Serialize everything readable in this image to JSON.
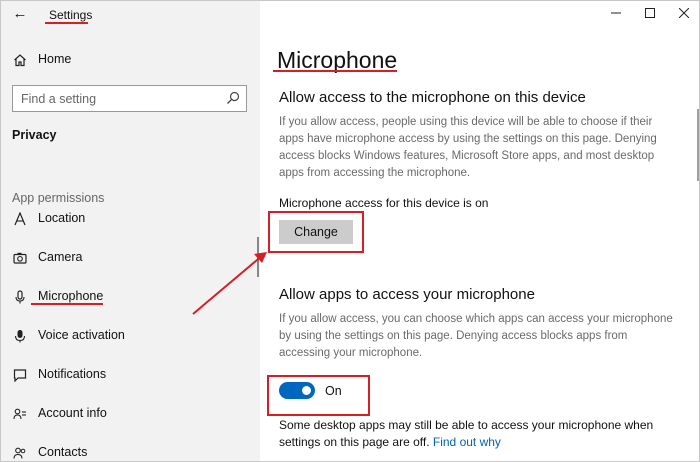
{
  "window": {
    "app_title": "Settings",
    "controls": [
      {
        "name": "minimize",
        "icon": "minimize-icon"
      },
      {
        "name": "maximize",
        "icon": "maximize-icon"
      },
      {
        "name": "close",
        "icon": "close-icon"
      }
    ]
  },
  "sidebar": {
    "home_label": "Home",
    "search_placeholder": "Find a setting",
    "section_heading": "Privacy",
    "group_label": "App permissions",
    "items": [
      {
        "label": "Location",
        "icon": "location-icon"
      },
      {
        "label": "Camera",
        "icon": "camera-icon"
      },
      {
        "label": "Microphone",
        "icon": "microphone-icon",
        "selected": true
      },
      {
        "label": "Voice activation",
        "icon": "voice-activation-icon"
      },
      {
        "label": "Notifications",
        "icon": "notifications-icon"
      },
      {
        "label": "Account info",
        "icon": "account-info-icon"
      },
      {
        "label": "Contacts",
        "icon": "contacts-icon"
      }
    ]
  },
  "main": {
    "title": "Microphone",
    "device_section": {
      "heading": "Allow access to the microphone on this device",
      "description": "If you allow access, people using this device will be able to choose if their apps have microphone access by using the settings on this page. Denying access blocks Windows features, Microsoft Store apps, and most desktop apps from accessing the microphone.",
      "status": "Microphone access for this device is on",
      "change_button": "Change"
    },
    "apps_section": {
      "heading": "Allow apps to access your microphone",
      "description": "If you allow access, you can choose which apps can access your microphone by using the settings on this page. Denying access blocks apps from accessing your microphone.",
      "toggle_state": "On",
      "toggle_on": true
    },
    "footer_text": "Some desktop apps may still be able to access your microphone when settings on this page are off.",
    "footer_link": "Find out why"
  },
  "colors": {
    "sidebar_bg": "#f2f2f2",
    "accent": "#0067c0",
    "link": "#0063b1",
    "annotation": "#d71d25",
    "button_bg": "#cccccc"
  }
}
